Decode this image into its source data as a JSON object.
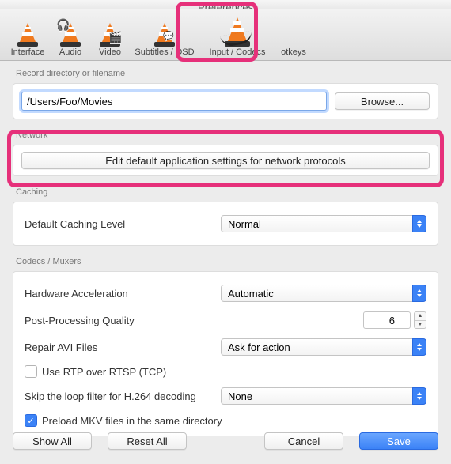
{
  "window": {
    "title": "Preferences"
  },
  "tabs": {
    "interface": "Interface",
    "audio": "Audio",
    "video": "Video",
    "subtitles": "Subtitles / OSD",
    "codecs": "Input / Codecs",
    "hotkeys": "otkeys"
  },
  "record": {
    "group_title": "Record directory or filename",
    "path": "/Users/Foo/Movies",
    "browse": "Browse..."
  },
  "network": {
    "group_title": "Network",
    "button": "Edit default application settings for network protocols"
  },
  "caching": {
    "group_title": "Caching",
    "default_level_label": "Default Caching Level",
    "default_level_value": "Normal"
  },
  "codecs": {
    "group_title": "Codecs / Muxers",
    "hw_accel_label": "Hardware Acceleration",
    "hw_accel_value": "Automatic",
    "pp_quality_label": "Post-Processing Quality",
    "pp_quality_value": "6",
    "repair_avi_label": "Repair AVI Files",
    "repair_avi_value": "Ask for action",
    "rtp_label": "Use RTP over RTSP (TCP)",
    "rtp_checked": false,
    "skip_loop_label": "Skip the loop filter for H.264 decoding",
    "skip_loop_value": "None",
    "preload_mkv_label": "Preload MKV files in the same directory",
    "preload_mkv_checked": true
  },
  "footer": {
    "show_all": "Show All",
    "reset_all": "Reset All",
    "cancel": "Cancel",
    "save": "Save"
  }
}
